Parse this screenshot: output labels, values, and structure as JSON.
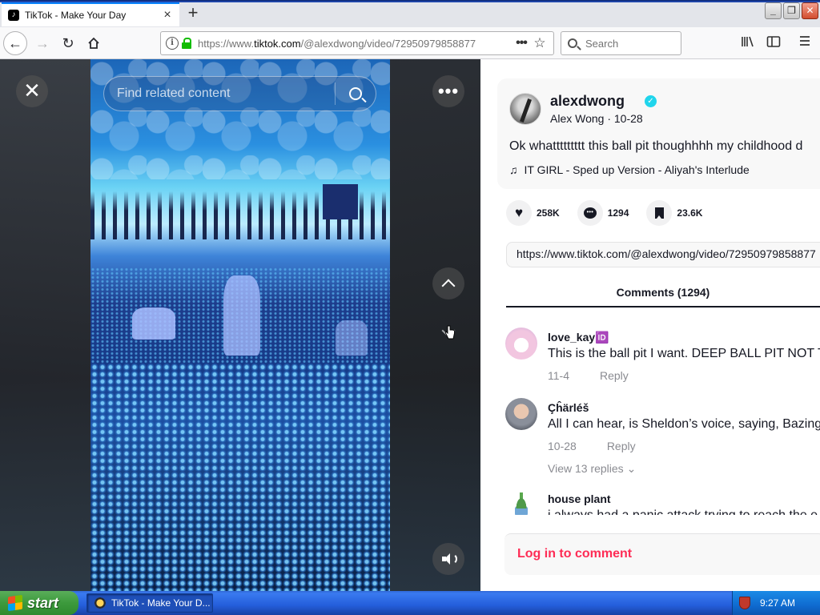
{
  "browser": {
    "tab_title": "TikTok - Make Your Day",
    "tab_close": "×",
    "new_tab": "+",
    "url_host": "https://www.",
    "url_domain": "tiktok.com",
    "url_path": "/@alexdwong/video/72950979858877",
    "search_placeholder": "Search",
    "window_buttons": [
      "_",
      "❐",
      "✕"
    ]
  },
  "video": {
    "close_label": "✕",
    "find_placeholder": "Find related content",
    "more_label": "•••"
  },
  "post": {
    "username": "alexdwong",
    "verified_mark": "✓",
    "nickname_date": "Alex Wong · 10-28",
    "description": "Ok whattttttttt this ball pit thoughhhh my childhood d",
    "music": "IT GIRL - Sped up Version - Aliyah's Interlude",
    "likes": "258K",
    "comments": "1294",
    "saves": "23.6K",
    "link": "https://www.tiktok.com/@alexdwong/video/72950979858877"
  },
  "tabs": {
    "comments_tab": "Comments (1294)"
  },
  "comments": [
    {
      "user": "love_kay🆔",
      "text": "This is the ball pit I want. DEEP BALL PIT NOT T",
      "date": "11-4",
      "reply": "Reply"
    },
    {
      "user": "Çĥärléš",
      "text": "All I can hear, is Sheldon’s voice, saying, Bazing",
      "date": "10-28",
      "reply": "Reply",
      "view_replies": "View 13 replies ⌄"
    },
    {
      "user": "house plant",
      "text": "i always had a panic attack trying to reach the e"
    }
  ],
  "login": {
    "label": "Log in to comment"
  },
  "taskbar": {
    "start_label": "start",
    "task_title": "TikTok - Make Your D...",
    "clock": "9:27 AM"
  },
  "colors": {
    "accent": "#fe2c55",
    "verified": "#20d5ec",
    "firefox_blue": "#0a84ff"
  }
}
